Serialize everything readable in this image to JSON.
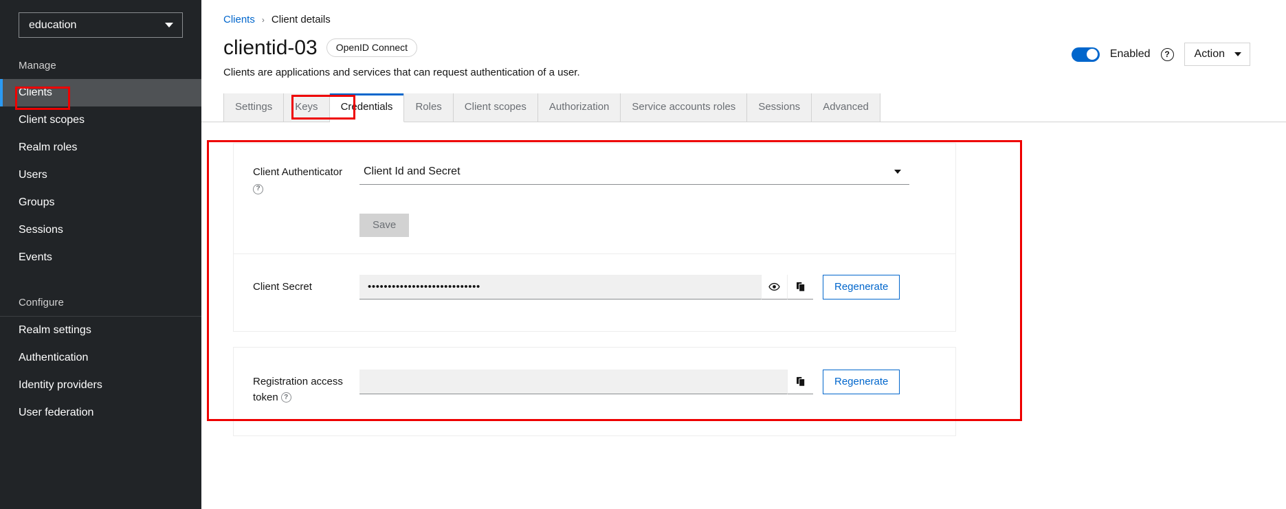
{
  "sidebar": {
    "realm_selector": {
      "value": "education",
      "icon": "chevron-down-icon"
    },
    "manage_title": "Manage",
    "manage_items": [
      {
        "label": "Clients",
        "active": true
      },
      {
        "label": "Client scopes",
        "active": false
      },
      {
        "label": "Realm roles",
        "active": false
      },
      {
        "label": "Users",
        "active": false
      },
      {
        "label": "Groups",
        "active": false
      },
      {
        "label": "Sessions",
        "active": false
      },
      {
        "label": "Events",
        "active": false
      }
    ],
    "configure_title": "Configure",
    "configure_items": [
      {
        "label": "Realm settings"
      },
      {
        "label": "Authentication"
      },
      {
        "label": "Identity providers"
      },
      {
        "label": "User federation"
      }
    ]
  },
  "breadcrumb": {
    "parent": "Clients",
    "separator": "›",
    "current": "Client details"
  },
  "header": {
    "title": "clientid-03",
    "protocol_badge": "OpenID Connect",
    "subtitle": "Clients are applications and services that can request authentication of a user.",
    "enabled_label": "Enabled",
    "enabled_state": true,
    "help_icon": "question-circle-icon",
    "action_label": "Action",
    "action_caret": "caret-down-icon"
  },
  "tabs": [
    {
      "label": "Settings",
      "active": false
    },
    {
      "label": "Keys",
      "active": false
    },
    {
      "label": "Credentials",
      "active": true
    },
    {
      "label": "Roles",
      "active": false
    },
    {
      "label": "Client scopes",
      "active": false
    },
    {
      "label": "Authorization",
      "active": false
    },
    {
      "label": "Service accounts roles",
      "active": false
    },
    {
      "label": "Sessions",
      "active": false
    },
    {
      "label": "Advanced",
      "active": false
    }
  ],
  "credentials": {
    "authenticator": {
      "label": "Client Authenticator",
      "help_icon": "question-circle-icon",
      "selected": "Client Id and Secret",
      "caret": "caret-down-icon",
      "save_label": "Save",
      "save_disabled": true
    },
    "client_secret": {
      "label": "Client Secret",
      "value": "••••••••••••••••••••••••••••",
      "show_icon": "eye-icon",
      "copy_icon": "copy-icon",
      "regenerate_label": "Regenerate"
    },
    "registration_token": {
      "label_line1": "Registration access",
      "label_line2": "token",
      "help_icon": "question-circle-icon",
      "value": "",
      "copy_icon": "copy-icon",
      "regenerate_label": "Regenerate"
    }
  },
  "colors": {
    "accent_blue": "#06c",
    "annotation_red": "#ee0000",
    "sidebar_bg": "#212427",
    "active_nav_bg": "#4f5255"
  }
}
